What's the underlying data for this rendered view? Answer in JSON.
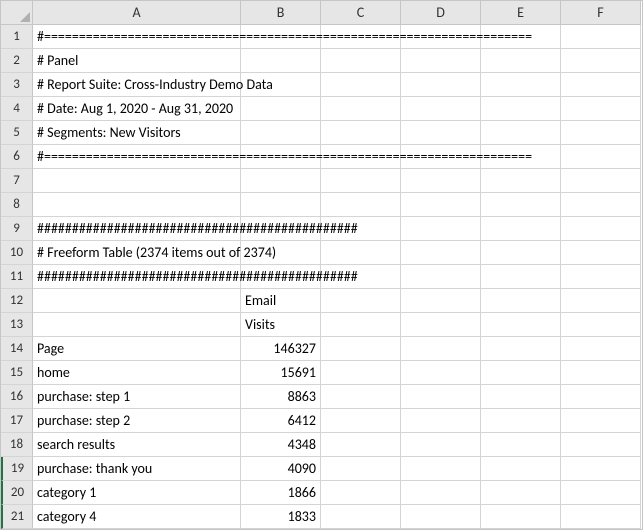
{
  "columns": [
    "A",
    "B",
    "C",
    "D",
    "E",
    "F"
  ],
  "rowCount": 21,
  "meta": {
    "separator_eq": "#======================================================================",
    "panel": "# Panel",
    "report_suite": "# Report Suite: Cross-Industry Demo Data",
    "date": "# Date: Aug 1, 2020 - Aug 31, 2020",
    "segments": "# Segments: New Visitors",
    "separator_hash": "##############################################",
    "freeform_title": "# Freeform Table (2374 items out of 2374)",
    "header_b12": "Email",
    "header_b13": "Visits",
    "header_a14": "Page"
  },
  "data_rows": [
    {
      "page": "Page",
      "visits": "146327"
    },
    {
      "page": "home",
      "visits": "15691"
    },
    {
      "page": "purchase: step 1",
      "visits": "8863"
    },
    {
      "page": "purchase: step 2",
      "visits": "6412"
    },
    {
      "page": "search results",
      "visits": "4348"
    },
    {
      "page": "purchase: thank you",
      "visits": "4090"
    },
    {
      "page": "category 1",
      "visits": "1866"
    },
    {
      "page": "category 4",
      "visits": "1833"
    }
  ],
  "chart_data": {
    "type": "table",
    "title": "Freeform Table (2374 items out of 2374)",
    "columns": [
      "Page",
      "Visits (Email)"
    ],
    "rows": [
      [
        "Page",
        146327
      ],
      [
        "home",
        15691
      ],
      [
        "purchase: step 1",
        8863
      ],
      [
        "purchase: step 2",
        6412
      ],
      [
        "search results",
        4348
      ],
      [
        "purchase: thank you",
        4090
      ],
      [
        "category 1",
        1866
      ],
      [
        "category 4",
        1833
      ]
    ]
  }
}
